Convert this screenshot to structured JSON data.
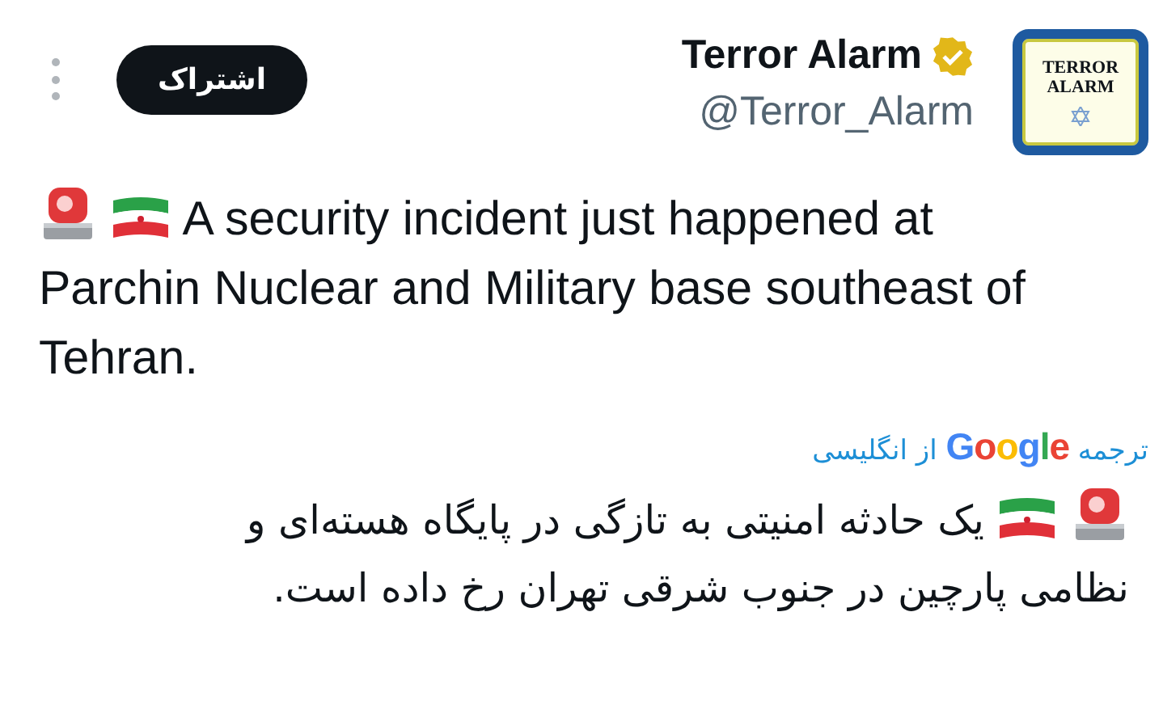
{
  "account": {
    "name": "Terror Alarm",
    "verified": true,
    "handle": "@Terror_Alarm",
    "avatar_lines": [
      "TERROR",
      "ALARM"
    ]
  },
  "subscribe_button": "اشتراک",
  "tweet": {
    "text": "A security incident just happened at Parchin Nuclear and Military base southeast of Tehran."
  },
  "translation": {
    "prefix": "ترجمه",
    "brand": "Google",
    "suffix": "از انگلیسی",
    "text": "یک حادثه امنیتی به تازگی در پایگاه هسته‌ای و نظامی پارچین در جنوب شرقی تهران رخ داده است."
  }
}
